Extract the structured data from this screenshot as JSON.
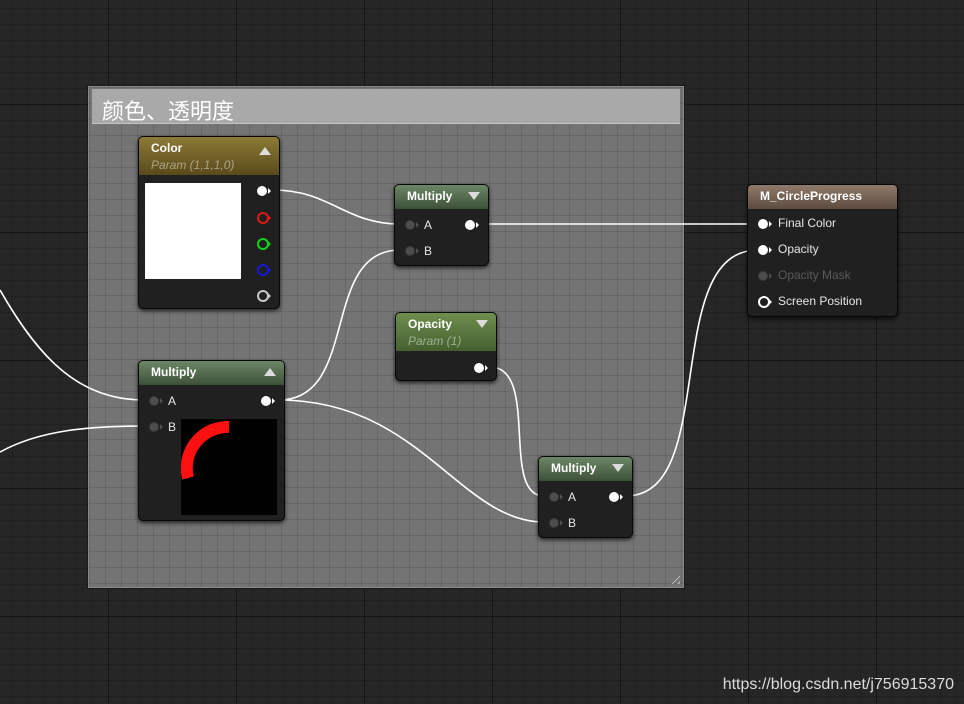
{
  "comment": {
    "title": "颜色、透明度"
  },
  "color_node": {
    "title": "Color",
    "subtitle": "Param (1,1,1,0)",
    "swatch_color": "#ffffff"
  },
  "multiply_node_1": {
    "title": "Multiply",
    "pin_a": "A",
    "pin_b": "B"
  },
  "multiply_node_2": {
    "title": "Multiply",
    "pin_a": "A",
    "pin_b": "B",
    "preview": "red-arc-on-black"
  },
  "opacity_node": {
    "title": "Opacity",
    "subtitle": "Param (1)"
  },
  "multiply_node_3": {
    "title": "Multiply",
    "pin_a": "A",
    "pin_b": "B"
  },
  "result_node": {
    "title": "M_CircleProgress",
    "pins": [
      "Final Color",
      "Opacity",
      "Opacity Mask",
      "Screen Position"
    ]
  },
  "watermark": "https://blog.csdn.net/j756915370",
  "colors": {
    "red": "#e01818",
    "green": "#18d018",
    "blue": "#1818d8",
    "wire": "#ffffff"
  }
}
